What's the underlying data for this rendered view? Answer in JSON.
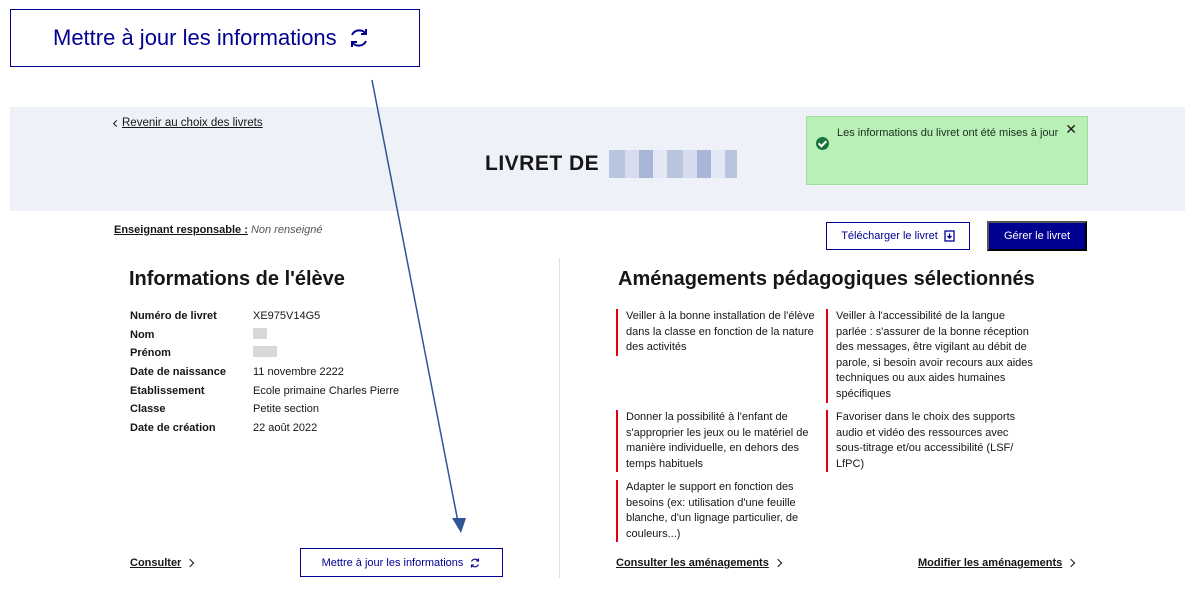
{
  "callout": {
    "label": "Mettre à jour les informations"
  },
  "header": {
    "back_link": "Revenir au choix des livrets",
    "title": "LIVRET DE"
  },
  "toast": {
    "message": "Les informations du livret ont été mises à jour",
    "close": "✕"
  },
  "teacher": {
    "label": "Enseignant responsable :",
    "value": "Non renseigné"
  },
  "actions": {
    "download": "Télécharger le livret",
    "manage": "Gérer le livret"
  },
  "student": {
    "heading": "Informations de l'élève",
    "rows": [
      {
        "label": "Numéro de livret",
        "value": "XE975V14G5"
      },
      {
        "label": "Nom",
        "value": ""
      },
      {
        "label": "Prénom",
        "value": ""
      },
      {
        "label": "Date de naissance",
        "value": "11 novembre 2222"
      },
      {
        "label": "Etablissement",
        "value": "Ecole primaine Charles Pierre"
      },
      {
        "label": "Classe",
        "value": "Petite section"
      },
      {
        "label": "Date de création",
        "value": "22 août 2022"
      }
    ],
    "consult": "Consulter",
    "update_button": "Mettre à jour les informations"
  },
  "amenagements": {
    "heading": "Aménagements pédagogiques sélectionnés",
    "items": [
      "Veiller à la bonne installation de l'élève dans la classe en fonction de la nature des activités",
      "Veiller à l'accessibilité de la langue parlée : s'assurer de la bonne réception des messages, être vigilant au débit de parole, si besoin avoir recours aux aides techniques ou aux aides humaines spécifiques",
      "Donner la possibilité à l'enfant de s'approprier les jeux ou le matériel de manière individuelle, en dehors des temps habituels",
      "Favoriser dans le choix des supports audio et vidéo des ressources avec sous-titrage et/ou accessibilité (LSF/ LfPC)",
      "Adapter le support en fonction des besoins (ex: utilisation d'une feuille blanche, d'un lignage particulier, de couleurs...)"
    ],
    "consult": "Consulter les aménagements",
    "modify": "Modifier les aménagements"
  },
  "colors": {
    "primary": "#000091",
    "band": "#eef1f8",
    "toast": "#b8f0b8",
    "accent_bar": "#e1000f"
  }
}
